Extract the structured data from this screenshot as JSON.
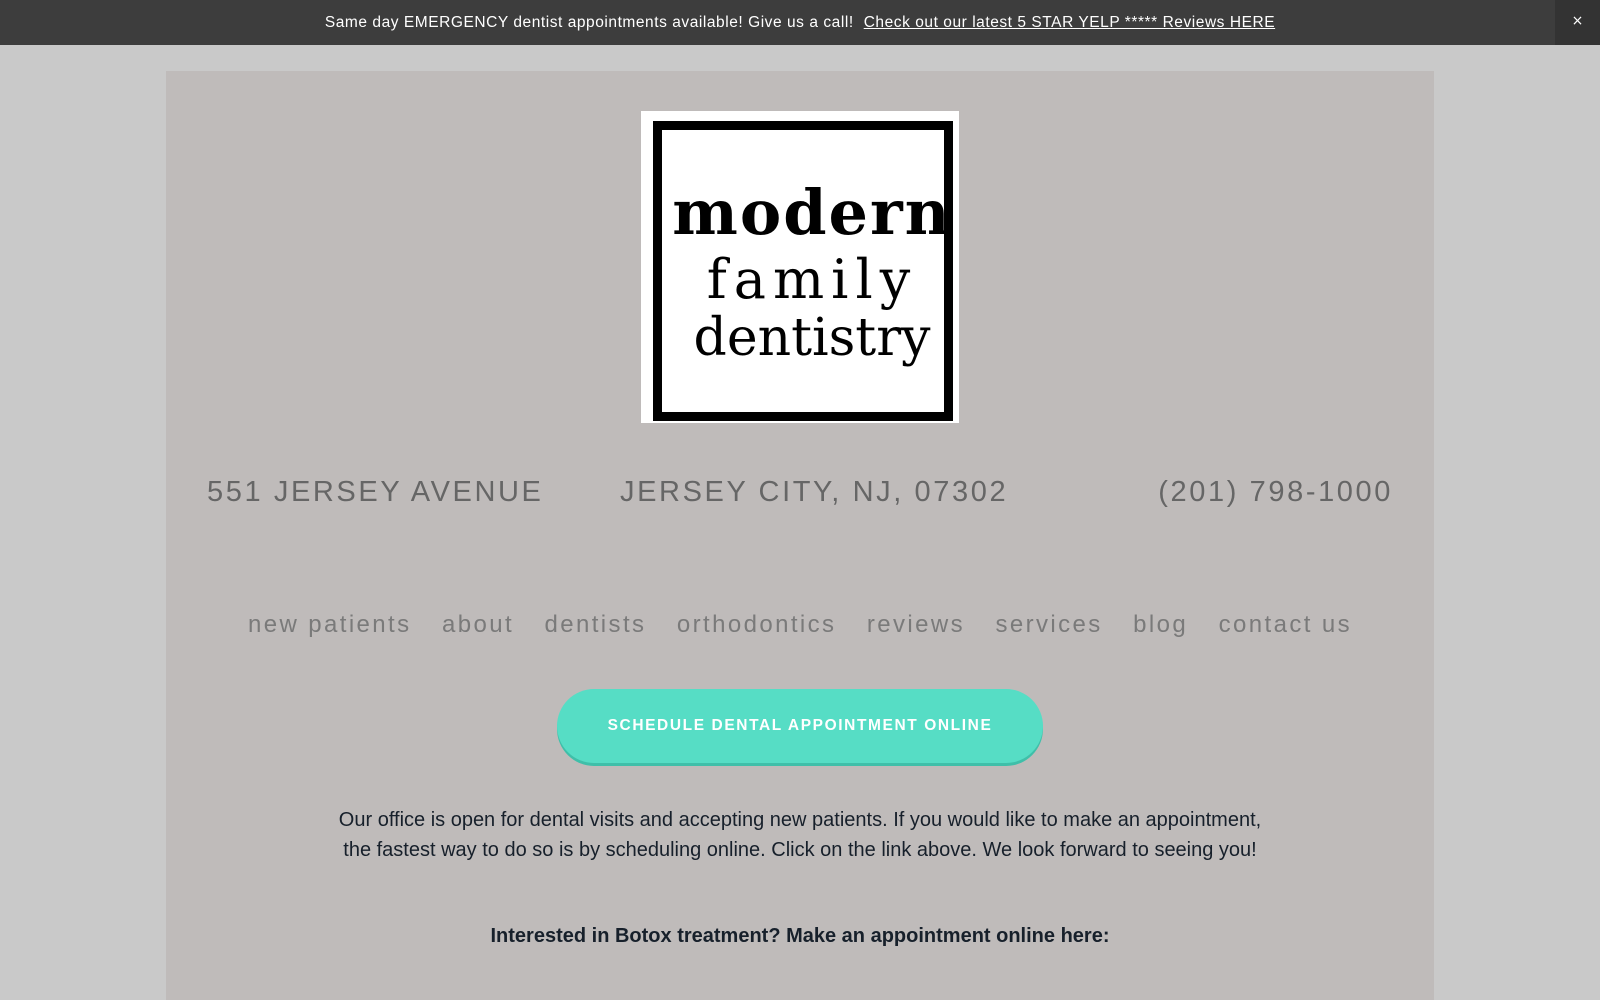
{
  "announcement": {
    "text": "Same day EMERGENCY dentist appointments available!  Give us a call!",
    "link_label": "Check out our latest 5 STAR YELP ***** Reviews HERE",
    "close_label": "×"
  },
  "logo": {
    "line1": "modern",
    "line2": "family",
    "line3": "dentistry"
  },
  "contact": {
    "address": "551 JERSEY AVENUE",
    "city": "JERSEY CITY, NJ, 07302",
    "phone": "(201) 798-1000"
  },
  "nav": {
    "items": [
      {
        "label": "new patients"
      },
      {
        "label": "about"
      },
      {
        "label": "dentists"
      },
      {
        "label": "orthodontics"
      },
      {
        "label": "reviews"
      },
      {
        "label": "services"
      },
      {
        "label": "blog"
      },
      {
        "label": "contact us"
      }
    ]
  },
  "cta": {
    "label": "SCHEDULE DENTAL APPOINTMENT ONLINE"
  },
  "main": {
    "paragraph": "Our office is open for dental visits and accepting new patients.  If you would like to make an appointment, the fastest way to do so is by scheduling online.  Click on the link above.  We look forward to seeing you!",
    "botox": "Interested in Botox treatment?  Make an appointment online here:"
  },
  "colors": {
    "page_background": "#c9c9c9",
    "panel_background": "#bfbbba",
    "topbar_background": "#3d3d3d",
    "accent": "#56ddc5",
    "nav_text": "#7a7a7a",
    "contact_text": "#666666"
  }
}
